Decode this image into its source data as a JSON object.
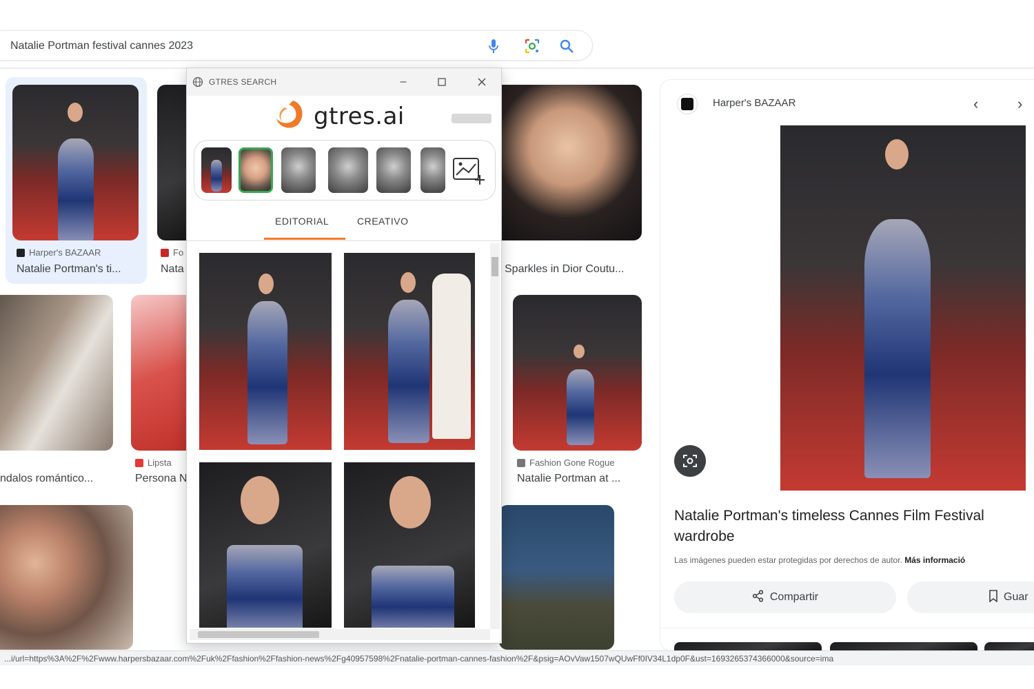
{
  "search": {
    "query": "Natalie Portman festival cannes 2023",
    "icons": [
      "microphone-icon",
      "lens-icon",
      "search-icon"
    ]
  },
  "results": [
    {
      "source": "Harper's BAZAAR",
      "title": "Natalie Portman's ti..."
    },
    {
      "source": "Fo",
      "title": "Nata"
    },
    {
      "source": "",
      "title": "Sparkles in Dior Coutu..."
    },
    {
      "source": "",
      "title": "ndalos romántico..."
    },
    {
      "source": "Lipsta",
      "title": "Persona N"
    },
    {
      "source": "Fashion Gone Rogue",
      "title": "Natalie Portman at ..."
    }
  ],
  "panel": {
    "source": "Harper's BAZAAR",
    "title": "Natalie Portman's timeless Cannes Film Festival wardrobe",
    "copyright": "Las imágenes pueden estar protegidas por derechos de autor.",
    "more_info": "Más informació",
    "share_label": "Compartir",
    "save_label": "Guar"
  },
  "gtres": {
    "window_title": "GTRES SEARCH",
    "brand": "gtres.ai",
    "tabs": [
      "EDITORIAL",
      "CREATIVO"
    ],
    "active_tab": "EDITORIAL",
    "accent": "#f07a28",
    "selected_face_color": "#35a853"
  },
  "status_url": "...i/url=https%3A%2F%2Fwww.harpersbazaar.com%2Fuk%2Ffashion%2Ffashion-news%2Fg40957598%2Fnatalie-portman-cannes-fashion%2F&psig=AOvVaw1507wQUwFf0IV34L1dp0F&ust=1693265374366000&source=ima"
}
